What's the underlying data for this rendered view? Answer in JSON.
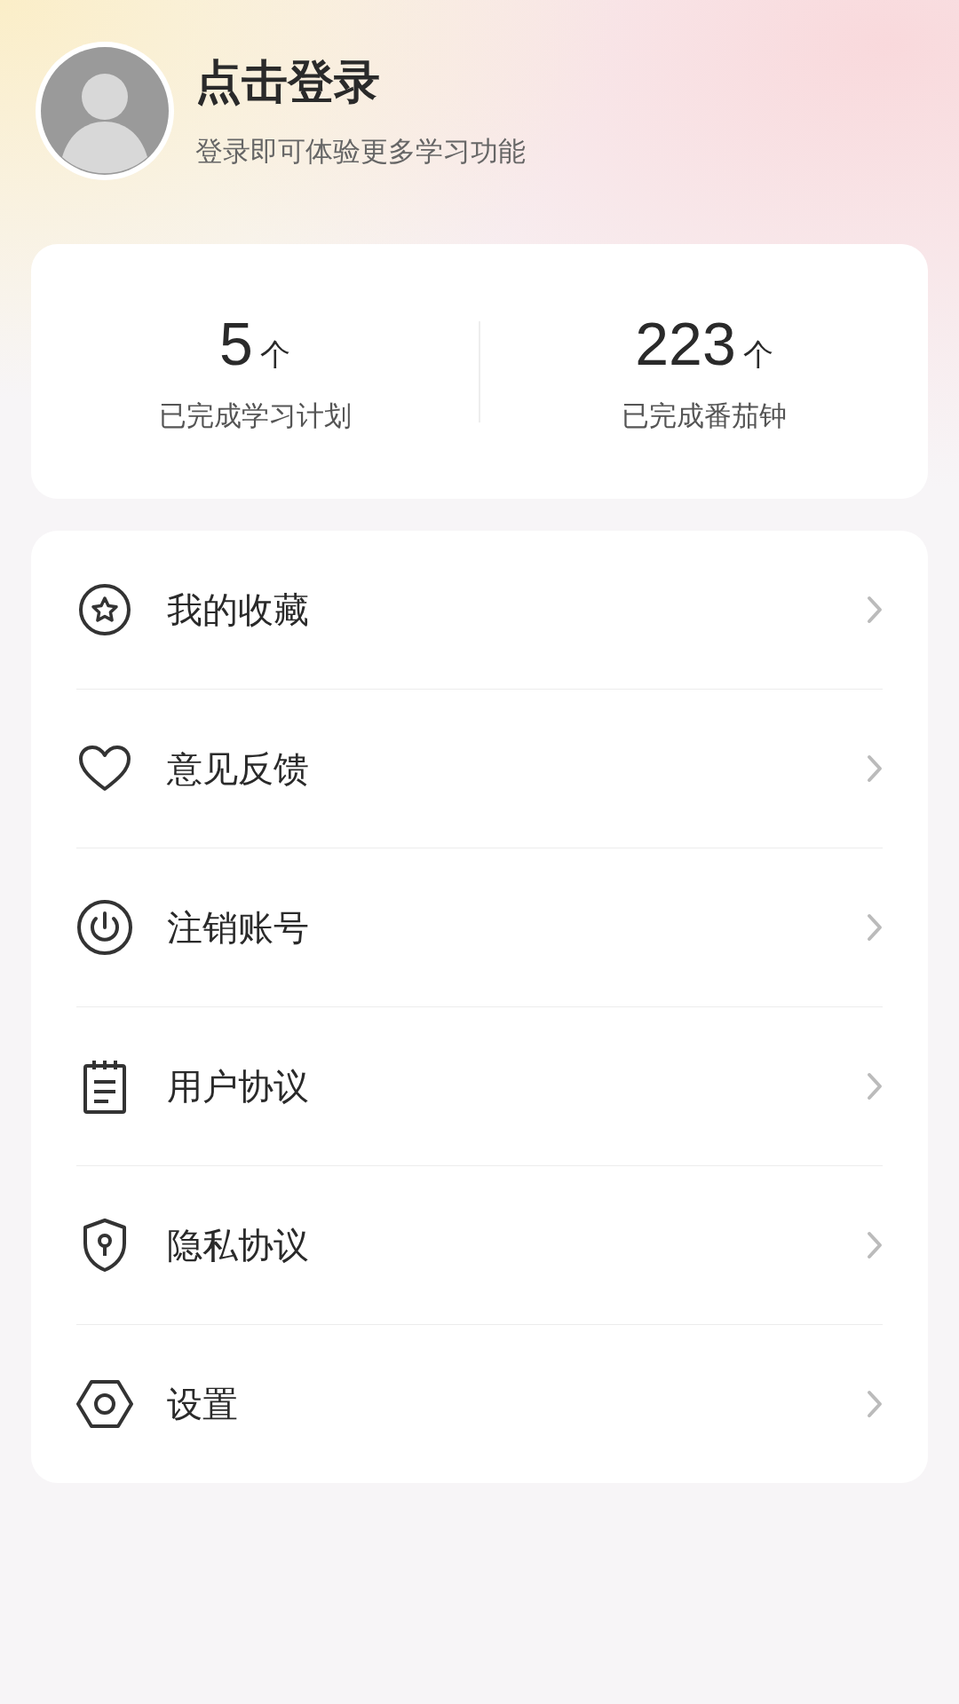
{
  "profile": {
    "title": "点击登录",
    "subtitle": "登录即可体验更多学习功能"
  },
  "stats": [
    {
      "value": "5",
      "unit": "个",
      "label": "已完成学习计划"
    },
    {
      "value": "223",
      "unit": "个",
      "label": "已完成番茄钟"
    }
  ],
  "menu": [
    {
      "kind": "star",
      "label": "我的收藏"
    },
    {
      "kind": "heart",
      "label": "意见反馈"
    },
    {
      "kind": "power",
      "label": "注销账号"
    },
    {
      "kind": "document",
      "label": "用户协议"
    },
    {
      "kind": "shield",
      "label": "隐私协议"
    },
    {
      "kind": "hexagon",
      "label": "设置"
    }
  ]
}
